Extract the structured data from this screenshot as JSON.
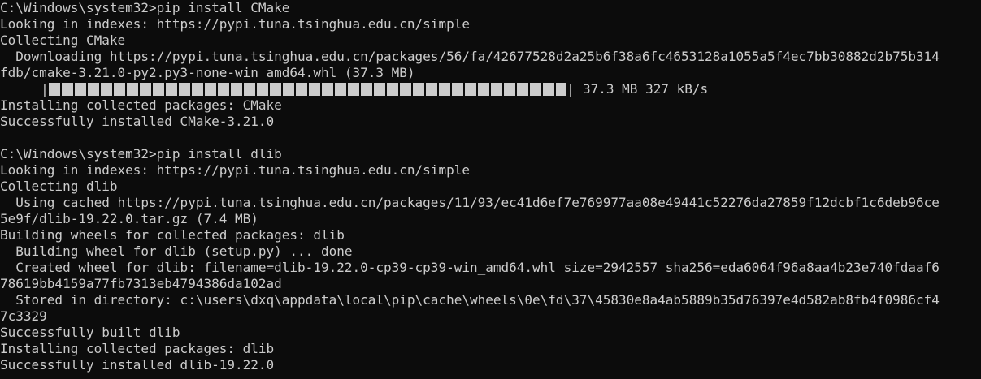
{
  "terminal": {
    "lines": [
      "C:\\Windows\\system32>pip install CMake",
      "Looking in indexes: https://pypi.tuna.tsinghua.edu.cn/simple",
      "Collecting CMake",
      "  Downloading https://pypi.tuna.tsinghua.edu.cn/packages/56/fa/42677528d2a25b6f38a6fc4653128a1055a5f4ec7bb30882d2b75b314",
      "fdb/cmake-3.21.0-py2.py3-none-win_amd64.whl (37.3 MB)",
      "__PROGRESS__",
      "Installing collected packages: CMake",
      "Successfully installed CMake-3.21.0",
      "",
      "C:\\Windows\\system32>pip install dlib",
      "Looking in indexes: https://pypi.tuna.tsinghua.edu.cn/simple",
      "Collecting dlib",
      "  Using cached https://pypi.tuna.tsinghua.edu.cn/packages/11/93/ec41d6ef7e769977aa08e49441c52276da27859f12dcbf1c6deb96ce",
      "5e9f/dlib-19.22.0.tar.gz (7.4 MB)",
      "Building wheels for collected packages: dlib",
      "  Building wheel for dlib (setup.py) ... done",
      "  Created wheel for dlib: filename=dlib-19.22.0-cp39-cp39-win_amd64.whl size=2942557 sha256=eda6064f96a8aa4b23e740fdaaf6",
      "78619bb4159a77fb7313eb4794386da102ad",
      "  Stored in directory: c:\\users\\dxq\\appdata\\local\\pip\\cache\\wheels\\0e\\fd\\37\\45830e8a4ab5889b35d76397e4d582ab8fb4f0986cf4",
      "7c3329",
      "Successfully built dlib",
      "Installing collected packages: dlib",
      "Successfully installed dlib-19.22.0"
    ],
    "progress": {
      "fraction": 1.0,
      "stats": "37.3 MB 327 kB/s"
    },
    "colors": {
      "background": "#0c0c0c",
      "text": "#cccccc"
    }
  }
}
